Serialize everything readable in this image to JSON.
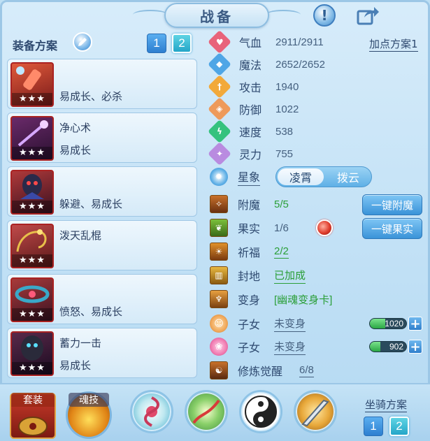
{
  "header": {
    "title": "战备",
    "info_icon": "!"
  },
  "left": {
    "plan_label": "装备方案",
    "plan_buttons": [
      "1",
      "2"
    ],
    "equipment": [
      {
        "name": "",
        "desc": "易成长、必杀",
        "stars": "★★★"
      },
      {
        "name": "净心术",
        "desc": "易成长",
        "stars": "★★★"
      },
      {
        "name": "",
        "desc": "躲避、易成长",
        "stars": "★★★"
      },
      {
        "name": "泼天乱棍",
        "desc": "",
        "stars": "★★★"
      },
      {
        "name": "",
        "desc": "愤怒、易成长",
        "stars": "★★★"
      },
      {
        "name": "蓄力一击",
        "desc": "易成长",
        "stars": "★★★"
      }
    ]
  },
  "stats": {
    "add_plan": "加点方案1",
    "rows": [
      {
        "label": "气血",
        "value": "2911/2911",
        "icon": "heart-icon",
        "color": "#e8637a",
        "glyph": "♥"
      },
      {
        "label": "魔法",
        "value": "2652/2652",
        "icon": "magic-icon",
        "color": "#4fa6e6",
        "glyph": "◆"
      },
      {
        "label": "攻击",
        "value": "1940",
        "icon": "attack-icon",
        "color": "#f2a93a",
        "glyph": "†"
      },
      {
        "label": "防御",
        "value": "1022",
        "icon": "defense-icon",
        "color": "#ee9a5a",
        "glyph": "◈"
      },
      {
        "label": "速度",
        "value": "538",
        "icon": "speed-icon",
        "color": "#35c27e",
        "glyph": "ϟ"
      },
      {
        "label": "灵力",
        "value": "755",
        "icon": "spirit-icon",
        "color": "#b98be0",
        "glyph": "✦"
      }
    ],
    "xingxiang_label": "星象",
    "xingxiang_options": [
      "凌霄",
      "拨云"
    ],
    "attach_label": "附魔",
    "attach_value": "5/5",
    "attach_button": "一键附魔",
    "fruit_label": "果实",
    "fruit_value": "1/6",
    "fruit_button": "一键果实",
    "bless_label": "祈福",
    "bless_value": "2/2",
    "seal_label": "封地",
    "seal_value": "已加成",
    "transform_label": "变身",
    "transform_value": "[幽魂变身卡]",
    "child1_label": "子女",
    "child1_value": "未变身",
    "child1_bar": "1020",
    "child2_label": "子女",
    "child2_value": "未变身",
    "child2_bar": "902",
    "cultivate_label": "修炼觉醒",
    "cultivate_value": "6/8"
  },
  "bottom": {
    "suit_label": "套装",
    "soul_label": "魂技",
    "mount_label": "坐骑方案",
    "mount_buttons": [
      "1",
      "2"
    ]
  }
}
